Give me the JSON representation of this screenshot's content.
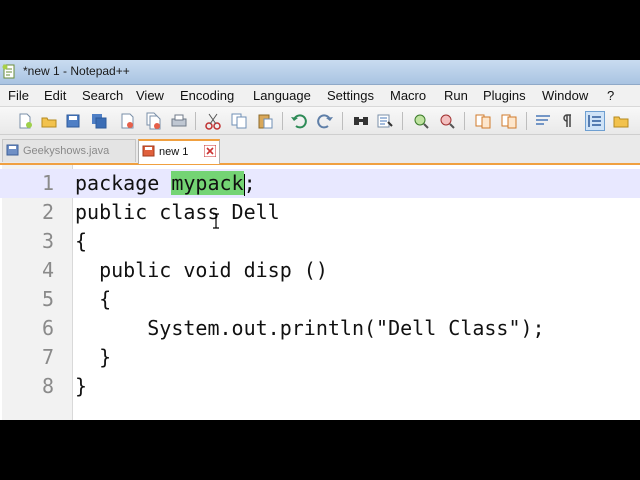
{
  "window": {
    "title": "*new 1 - Notepad++"
  },
  "menu": [
    "File",
    "Edit",
    "Search",
    "View",
    "Encoding",
    "Language",
    "Settings",
    "Macro",
    "Run",
    "Plugins",
    "Window",
    "?"
  ],
  "tabs": [
    {
      "label": "Geekyshows.java",
      "state": "inactive"
    },
    {
      "label": "new 1",
      "state": "active"
    }
  ],
  "editor": {
    "current_line": 1,
    "highlight_word": "mypack",
    "highlight_color": "#74d474",
    "lines": [
      {
        "n": "1",
        "before": "package ",
        "highlight": "mypack",
        "after": ";"
      },
      {
        "n": "2",
        "text": "public class Dell"
      },
      {
        "n": "3",
        "text": "{"
      },
      {
        "n": "4",
        "text": "  public void disp ()"
      },
      {
        "n": "5",
        "text": "  {"
      },
      {
        "n": "6",
        "text": "      System.out.println(\"Dell Class\");"
      },
      {
        "n": "7",
        "text": "  }"
      },
      {
        "n": "8",
        "text": "}"
      }
    ]
  },
  "toolbar_icons": [
    "new-file-icon",
    "open-file-icon",
    "save-icon",
    "save-all-icon",
    "close-icon",
    "close-all-icon",
    "print-icon",
    "cut-icon",
    "copy-icon",
    "paste-icon",
    "undo-icon",
    "redo-icon",
    "find-icon",
    "find-replace-icon",
    "zoom-in-icon",
    "zoom-out-icon",
    "sync-v-icon",
    "sync-h-icon",
    "word-wrap-icon",
    "show-all-chars-icon",
    "indent-guide-icon",
    "folder-icon"
  ]
}
